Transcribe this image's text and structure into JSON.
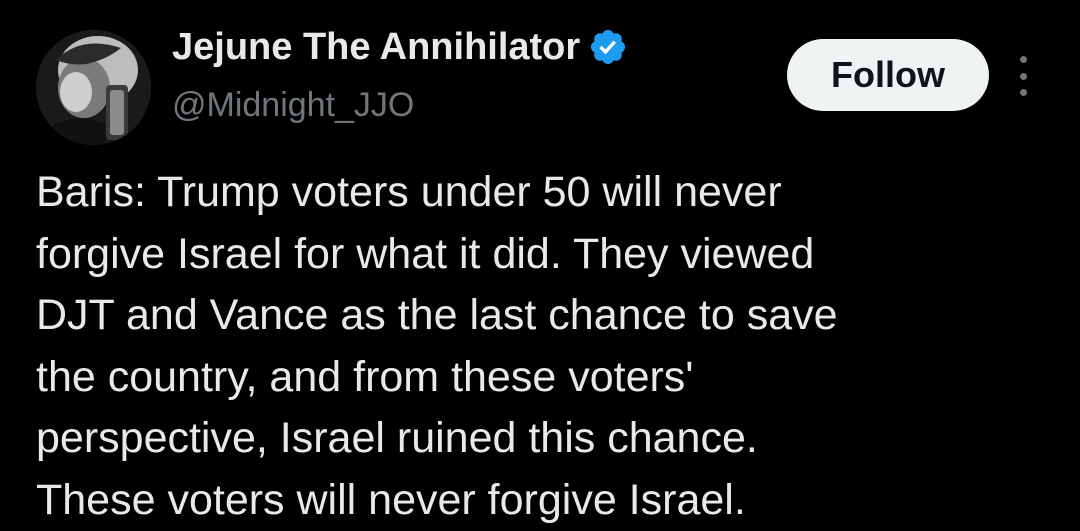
{
  "author": {
    "display_name": "Jejune The Annihilator",
    "handle": "@Midnight_JJO",
    "verified": true,
    "avatar_icon": "profile-photo"
  },
  "actions": {
    "follow_label": "Follow",
    "more_icon": "more-vertical-icon"
  },
  "tweet": {
    "text": "Baris: Trump voters under 50 will never\nforgive Israel for what it did. They viewed\nDJT and Vance as the last chance to save\nthe country, and from these voters'\nperspective, Israel ruined this chance.\nThese voters will never forgive Israel."
  },
  "colors": {
    "background": "#000000",
    "primary_text": "#e7e9ea",
    "secondary_text": "#71767b",
    "verified_badge": "#1d9bf0",
    "follow_button_bg": "#eff3f4",
    "follow_button_text": "#0f1419"
  }
}
